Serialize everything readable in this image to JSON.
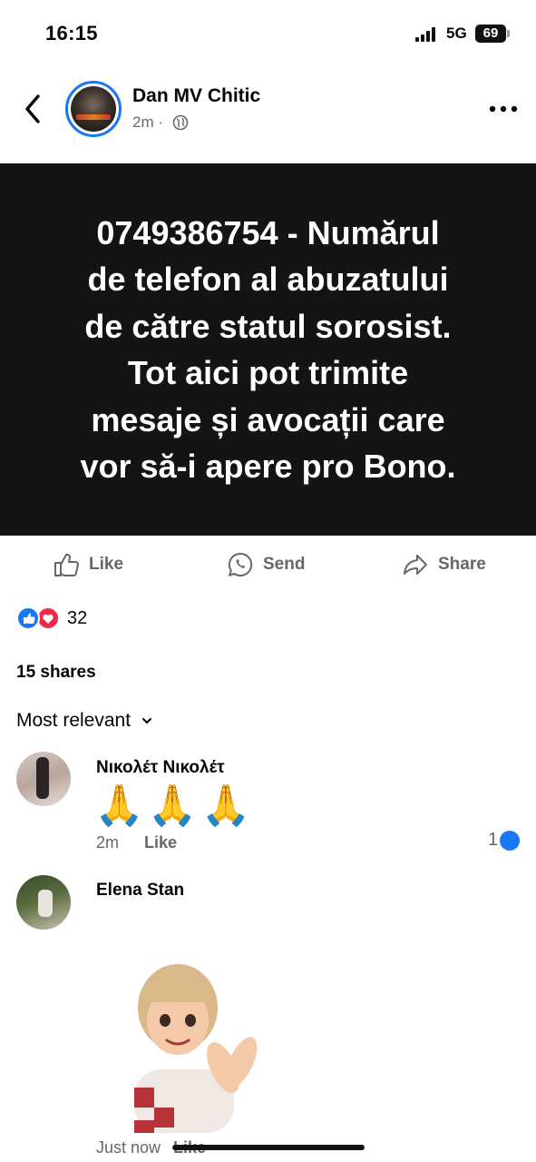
{
  "status_bar": {
    "time": "16:15",
    "network": "5G",
    "battery": "69"
  },
  "post": {
    "author": "Dan MV Chitic",
    "time": "2m",
    "separator": "·",
    "text": "0749386754 - Numărul\nde telefon al abuzatului\nde către statul sorosist.\nTot aici pot trimite\nmesaje și avocații care\nvor să-i apere pro Bono.",
    "background_color": "#141414",
    "text_color": "#ffffff"
  },
  "actions": {
    "like": "Like",
    "send": "Send",
    "share": "Share"
  },
  "reactions": {
    "count": "32",
    "types": [
      "like",
      "love"
    ]
  },
  "shares_text": "15 shares",
  "comments_sort": "Most relevant",
  "comments": [
    {
      "author": "Νικολέτ Νικολέτ",
      "body": "🙏🙏🙏",
      "time": "2m",
      "like_label": "Like",
      "reaction_count": "1"
    },
    {
      "author": "Elena Stan",
      "sticker": "clapping-avatar",
      "time": "Just now",
      "like_label": "Like"
    }
  ],
  "colors": {
    "accent": "#1877f2",
    "love": "#f02849",
    "secondary_text": "#65676b"
  }
}
